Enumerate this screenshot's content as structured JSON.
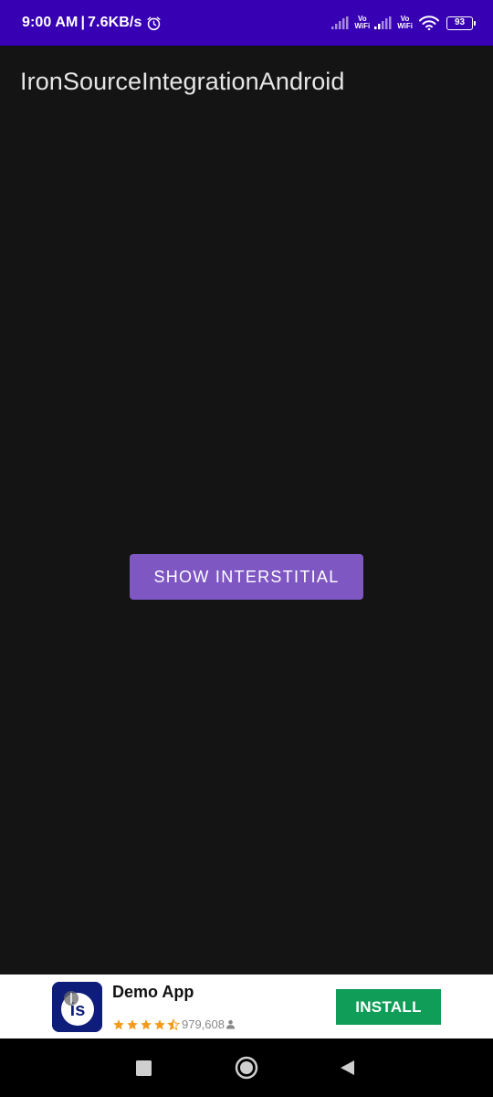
{
  "status_bar": {
    "time": "9:00 AM",
    "separator": "|",
    "speed": "7.6KB/s",
    "sim1_label_top": "Vo",
    "sim1_label_bottom": "WiFi",
    "sim2_label_top": "Vo",
    "sim2_label_bottom": "WiFi",
    "battery": "93",
    "icons": [
      "alarm-icon",
      "signal-icon",
      "signal-icon",
      "wifi-icon",
      "battery-icon"
    ]
  },
  "app_bar": {
    "title": "IronSourceIntegrationAndroid"
  },
  "main": {
    "button_label": "SHOW INTERSTITIAL",
    "button_color": "#7e57c2"
  },
  "ad_banner": {
    "app_name": "Demo App",
    "rating": 4.5,
    "rating_count": "979,608",
    "install_label": "INSTALL",
    "install_color": "#0f9d58",
    "icon_bg": "#0f1d7a",
    "icons": [
      "app-logo-icon",
      "star-icon",
      "person-icon"
    ]
  },
  "nav_bar": {
    "buttons": [
      "recents-icon",
      "home-icon",
      "back-icon"
    ]
  },
  "colors": {
    "status_bar": "#3700b3",
    "background": "#141414",
    "title_text": "#e6e6e6",
    "star": "#f29b1c"
  }
}
